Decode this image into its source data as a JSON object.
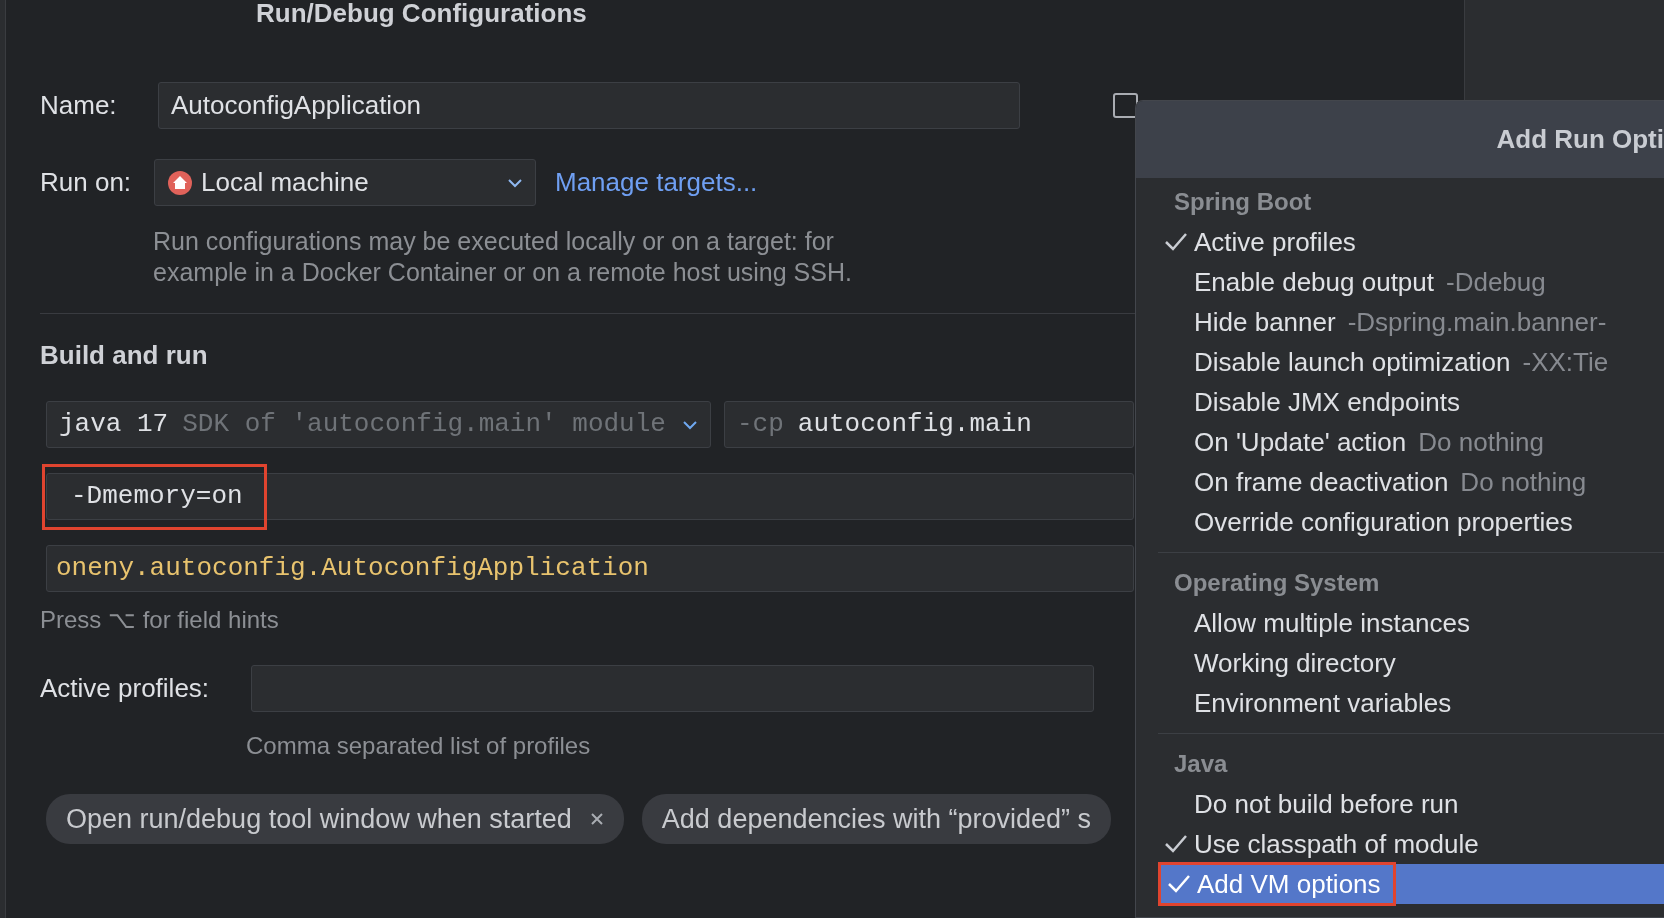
{
  "dialog": {
    "title": "Run/Debug Configurations",
    "name_label": "Name:",
    "name_value": "AutoconfigApplication",
    "store_checkbox": {
      "checked": false
    },
    "run_on_label": "Run on:",
    "run_on_value": "Local machine",
    "manage_targets_link": "Manage targets...",
    "run_on_description": [
      "Run configurations may be executed locally or on a target: for",
      "example in a Docker Container or on a remote host using SSH."
    ],
    "build_and_run": {
      "heading": "Build and run",
      "jdk": {
        "value": "java 17",
        "hint": "SDK of 'autoconfig.main' module"
      },
      "classpath": {
        "flag": "-cp",
        "value": "autoconfig.main"
      },
      "vm_options": {
        "value": "-Dmemory=on",
        "highlighted": true
      },
      "main_class": "oneny.autoconfig.AutoconfigApplication",
      "field_hint": "Press ⌥ for field hints"
    },
    "active_profiles": {
      "label": "Active profiles:",
      "hint": "Comma separated list of profiles"
    },
    "option_chips": [
      {
        "label": "Open run/debug tool window when started",
        "removable": true
      },
      {
        "label": "Add dependencies with “provided” s",
        "removable": false
      }
    ]
  },
  "popup": {
    "title": "Add Run Opti",
    "sections": [
      {
        "heading": "Spring Boot",
        "items": [
          {
            "label": "Active profiles",
            "checked": true,
            "selected": false,
            "highlighted": false
          },
          {
            "label": "Enable debug output",
            "hint": "-Ddebug",
            "checked": false,
            "selected": false,
            "highlighted": false
          },
          {
            "label": "Hide banner",
            "hint": "-Dspring.main.banner-",
            "checked": false,
            "selected": false,
            "highlighted": false
          },
          {
            "label": "Disable launch optimization",
            "hint": "-XX:Tie",
            "checked": false,
            "selected": false,
            "highlighted": false
          },
          {
            "label": "Disable JMX endpoints",
            "checked": false,
            "selected": false,
            "highlighted": false
          },
          {
            "label": "On 'Update' action",
            "hint": "Do nothing",
            "checked": false,
            "selected": false,
            "highlighted": false
          },
          {
            "label": "On frame deactivation",
            "hint": "Do nothing",
            "checked": false,
            "selected": false,
            "highlighted": false
          },
          {
            "label": "Override configuration properties",
            "checked": false,
            "selected": false,
            "highlighted": false
          }
        ]
      },
      {
        "heading": "Operating System",
        "items": [
          {
            "label": "Allow multiple instances",
            "checked": false,
            "selected": false,
            "highlighted": false
          },
          {
            "label": "Working directory",
            "checked": false,
            "selected": false,
            "highlighted": false
          },
          {
            "label": "Environment variables",
            "checked": false,
            "selected": false,
            "highlighted": false
          }
        ]
      },
      {
        "heading": "Java",
        "items": [
          {
            "label": "Do not build before run",
            "checked": false,
            "selected": false,
            "highlighted": false
          },
          {
            "label": "Use classpath of module",
            "checked": true,
            "selected": false,
            "highlighted": false
          },
          {
            "label": "Add VM options",
            "checked": true,
            "selected": true,
            "highlighted": true
          }
        ]
      }
    ]
  }
}
